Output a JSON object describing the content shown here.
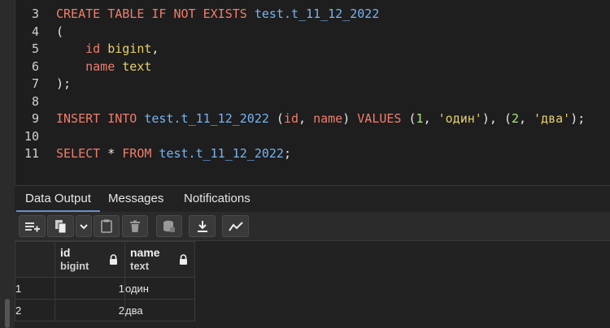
{
  "editor": {
    "lines": [
      {
        "num": "3",
        "tokens": [
          {
            "t": "CREATE TABLE IF NOT EXISTS ",
            "c": "kw"
          },
          {
            "t": "test.t_11_12_2022",
            "c": "id"
          }
        ]
      },
      {
        "num": "4",
        "tokens": [
          {
            "t": "(",
            "c": "pn"
          }
        ]
      },
      {
        "num": "5",
        "tokens": [
          {
            "t": "    ",
            "c": "pn"
          },
          {
            "t": "id",
            "c": "col"
          },
          {
            "t": " bigint",
            "c": "ty"
          },
          {
            "t": ",",
            "c": "pn"
          }
        ]
      },
      {
        "num": "6",
        "tokens": [
          {
            "t": "    ",
            "c": "pn"
          },
          {
            "t": "name",
            "c": "col"
          },
          {
            "t": " text",
            "c": "ty"
          }
        ]
      },
      {
        "num": "7",
        "tokens": [
          {
            "t": ");",
            "c": "pn"
          }
        ]
      },
      {
        "num": "8",
        "tokens": []
      },
      {
        "num": "9",
        "tokens": [
          {
            "t": "INSERT INTO ",
            "c": "kw"
          },
          {
            "t": "test.t_11_12_2022",
            "c": "id"
          },
          {
            "t": " (",
            "c": "pn"
          },
          {
            "t": "id",
            "c": "col"
          },
          {
            "t": ", ",
            "c": "pn"
          },
          {
            "t": "name",
            "c": "col"
          },
          {
            "t": ") ",
            "c": "pn"
          },
          {
            "t": "VALUES",
            "c": "kw"
          },
          {
            "t": " (",
            "c": "pn"
          },
          {
            "t": "1",
            "c": "num"
          },
          {
            "t": ", ",
            "c": "pn"
          },
          {
            "t": "'один'",
            "c": "str"
          },
          {
            "t": "), (",
            "c": "pn"
          },
          {
            "t": "2",
            "c": "num"
          },
          {
            "t": ", ",
            "c": "pn"
          },
          {
            "t": "'два'",
            "c": "str"
          },
          {
            "t": ");",
            "c": "pn"
          }
        ]
      },
      {
        "num": "10",
        "tokens": []
      },
      {
        "num": "11",
        "tokens": [
          {
            "t": "SELECT ",
            "c": "kw"
          },
          {
            "t": "* ",
            "c": "pn"
          },
          {
            "t": "FROM ",
            "c": "kw"
          },
          {
            "t": "test.t_11_12_2022",
            "c": "id"
          },
          {
            "t": ";",
            "c": "pn"
          }
        ]
      }
    ]
  },
  "tabs": [
    {
      "label": "Data Output",
      "name": "tab-data-output",
      "active": true
    },
    {
      "label": "Messages",
      "name": "tab-messages",
      "active": false
    },
    {
      "label": "Notifications",
      "name": "tab-notifications",
      "active": false
    }
  ],
  "toolbar": {
    "buttons": [
      {
        "name": "add-row-button",
        "icon": "add-row-icon"
      },
      {
        "name": "copy-button",
        "icon": "copy-icon"
      },
      {
        "name": "copy-options-dropdown",
        "icon": "chevron-down-icon"
      },
      {
        "name": "paste-button",
        "icon": "paste-icon"
      },
      {
        "name": "delete-button",
        "icon": "trash-icon"
      },
      {
        "name": "save-data-button",
        "icon": "database-save-icon"
      },
      {
        "name": "download-button",
        "icon": "download-icon"
      },
      {
        "name": "graph-button",
        "icon": "graph-icon"
      }
    ]
  },
  "grid": {
    "columns": [
      {
        "name": "id",
        "type": "bigint",
        "locked": true
      },
      {
        "name": "name",
        "type": "text",
        "locked": true
      }
    ],
    "rows": [
      {
        "rownum": "1",
        "id": "1",
        "name": "один"
      },
      {
        "rownum": "2",
        "id": "2",
        "name": "два"
      }
    ]
  },
  "colors": {
    "keyword": "#f07d6c",
    "identifier": "#77b4f2",
    "type": "#e8d06a",
    "number": "#a6e87a",
    "active_tab_underline": "#6a8fc7"
  }
}
